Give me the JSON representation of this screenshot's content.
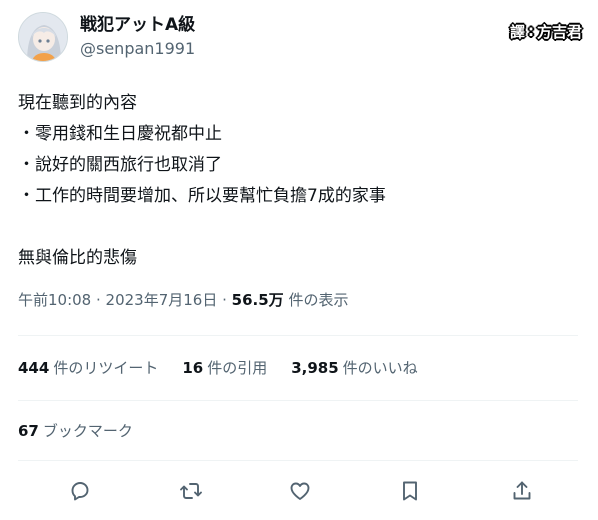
{
  "user": {
    "display_name": "戦犯アットA級",
    "handle": "@senpan1991"
  },
  "watermark": {
    "label": "譯",
    "separator": ":",
    "translator": "方吉君"
  },
  "tweet": {
    "lines": [
      "現在聽到的內容",
      "・零用錢和生日慶祝都中止",
      "・說好的關西旅行也取消了",
      "・工作的時間要增加、所以要幫忙負擔7成的家事",
      "",
      "無與倫比的悲傷"
    ]
  },
  "meta": {
    "time": "午前10:08",
    "sep1": " · ",
    "date": "2023年7月16日",
    "sep2": " · ",
    "views_count": "56.5万",
    "views_label": " 件の表示"
  },
  "stats": {
    "retweets_count": "444",
    "retweets_label": "件のリツイート",
    "quotes_count": "16",
    "quotes_label": "件の引用",
    "likes_count": "3,985",
    "likes_label": "件のいいね"
  },
  "bookmarks": {
    "count": "67",
    "label": "ブックマーク"
  },
  "actions": {
    "reply_icon": "reply-icon",
    "retweet_icon": "retweet-icon",
    "like_icon": "heart-icon",
    "bookmark_icon": "bookmark-icon",
    "share_icon": "share-icon"
  },
  "colors": {
    "text": "#0f1419",
    "secondary": "#536471",
    "divider": "#eff3f4"
  }
}
